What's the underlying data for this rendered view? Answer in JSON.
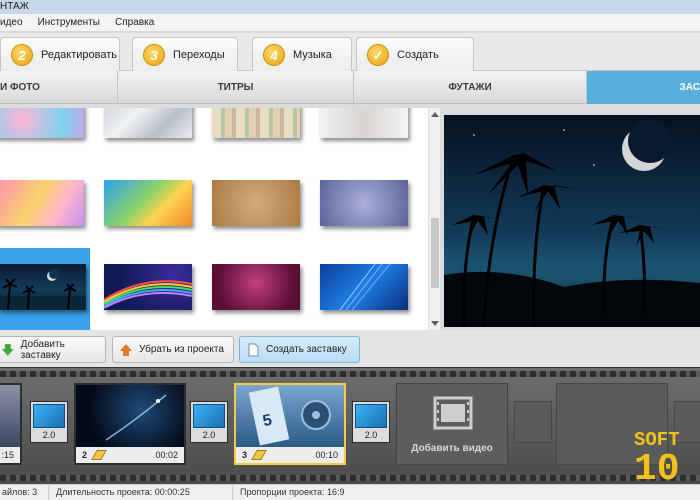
{
  "window": {
    "title": "НТАЖ"
  },
  "menu": [
    "идео",
    "Инструменты",
    "Справка"
  ],
  "main_tabs": [
    {
      "num": "2",
      "label": "Редактировать"
    },
    {
      "num": "3",
      "label": "Переходы"
    },
    {
      "num": "4",
      "label": "Музыка"
    },
    {
      "num": "",
      "label": "Создать"
    }
  ],
  "sub_tabs": [
    "И ФОТО",
    "ТИТРЫ",
    "ФУТАЖИ",
    "ЗАС"
  ],
  "buttons": {
    "add": "Добавить заставку",
    "remove": "Убрать из проекта",
    "create": "Создать заставку"
  },
  "timeline": {
    "clip1": {
      "n": "",
      "time": ":15"
    },
    "trans1": "2.0",
    "clip2": {
      "n": "2",
      "time": "00:02"
    },
    "trans2": "2.0",
    "clip3": {
      "n": "3",
      "time": "00:10"
    },
    "trans3": "2.0",
    "add_video": "Добавить видео"
  },
  "status": {
    "files": "айлов: 3",
    "duration": "Длительность проекта: 00:00:25",
    "ratio": "Пропорции проекта: 16:9"
  },
  "logo": {
    "line1": "SOFT",
    "line2": "10"
  },
  "colors": {
    "accent": "#58aedd",
    "selection": "#3aa0e8",
    "tab_number": "#f2b51e",
    "clip_selected": "#f5c94a"
  }
}
